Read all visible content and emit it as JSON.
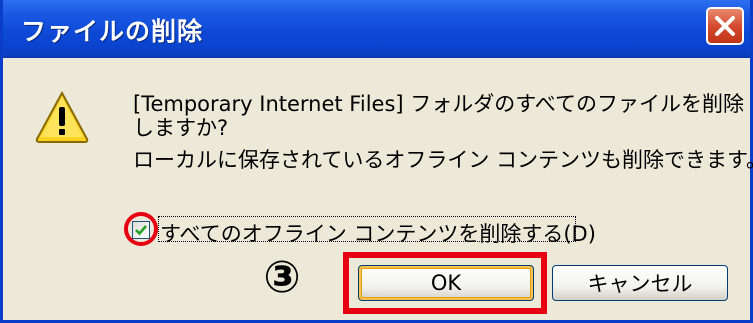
{
  "window": {
    "title": "ファイルの削除",
    "close_glyph": "✕"
  },
  "dialog": {
    "message_line1": "[Temporary Internet Files] フォルダのすべてのファイルを削除",
    "message_line2": "しますか?",
    "message_line3": "ローカルに保存されているオフライン コンテンツも削除できます。",
    "checkbox_label": "すべてのオフライン コンテンツを削除する(D)",
    "checkbox_checked": true,
    "ok_label": "OK",
    "cancel_label": "キャンセル"
  },
  "annotation": {
    "step_marker": "③",
    "highlight_color": "#e60012"
  },
  "icons": {
    "warning": "warning-icon",
    "close": "close-icon",
    "check": "checkmark-icon"
  },
  "colors": {
    "titlebar": "#0d49d6",
    "dialog_bg": "#ece9d8",
    "close_button": "#d2462a"
  }
}
